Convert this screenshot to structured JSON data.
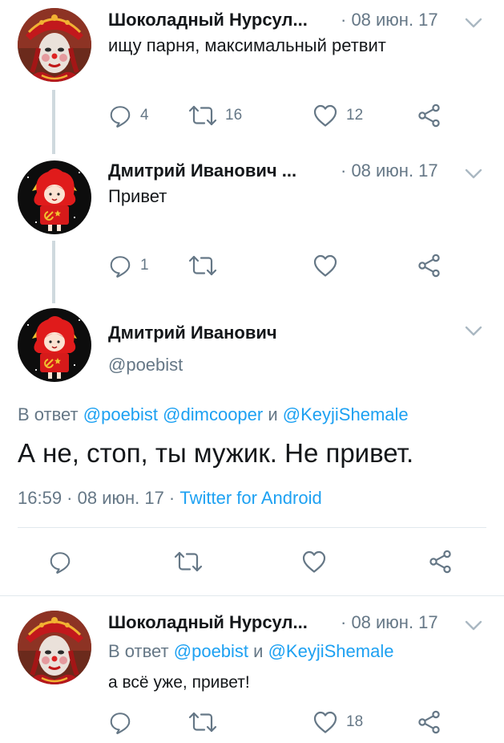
{
  "tweets": [
    {
      "name": "Шоколадный Нурсул...",
      "date": "· 08 июн. 17",
      "text": "ищу парня, максимальный ретвит",
      "reply_count": "4",
      "retweet_count": "16",
      "like_count": "12"
    },
    {
      "name": "Дмитрий Иванович ...",
      "date": "· 08 июн. 17",
      "text": "Привет",
      "reply_count": "1",
      "retweet_count": "",
      "like_count": ""
    }
  ],
  "focus": {
    "name": "Дмитрий Иванович",
    "handle": "@poebist",
    "reply_prefix": "В ответ",
    "reply_mention_1": "@poebist",
    "reply_mention_2": "@dimcooper",
    "reply_and": "и",
    "reply_mention_3": "@KeyjiShemale",
    "text": "А не, стоп, ты мужик. Не привет.",
    "time": "16:59 · 08 июн. 17 ·",
    "source": "Twitter for Android"
  },
  "last": {
    "name": "Шоколадный Нурсул...",
    "date": "· 08 июн. 17",
    "reply_prefix": "В ответ",
    "reply_mention_1": "@poebist",
    "reply_and": "и",
    "reply_mention_2": "@KeyjiShemale",
    "text": "а всё уже, привет!",
    "reply_count": "",
    "retweet_count": "",
    "like_count": "18"
  },
  "icons": {
    "reply": "reply-icon",
    "retweet": "retweet-icon",
    "like": "heart-icon",
    "share": "share-icon",
    "caret": "chevron-down-icon"
  },
  "colors": {
    "link": "#1da1f2",
    "muted": "#657786",
    "text": "#14171a"
  }
}
